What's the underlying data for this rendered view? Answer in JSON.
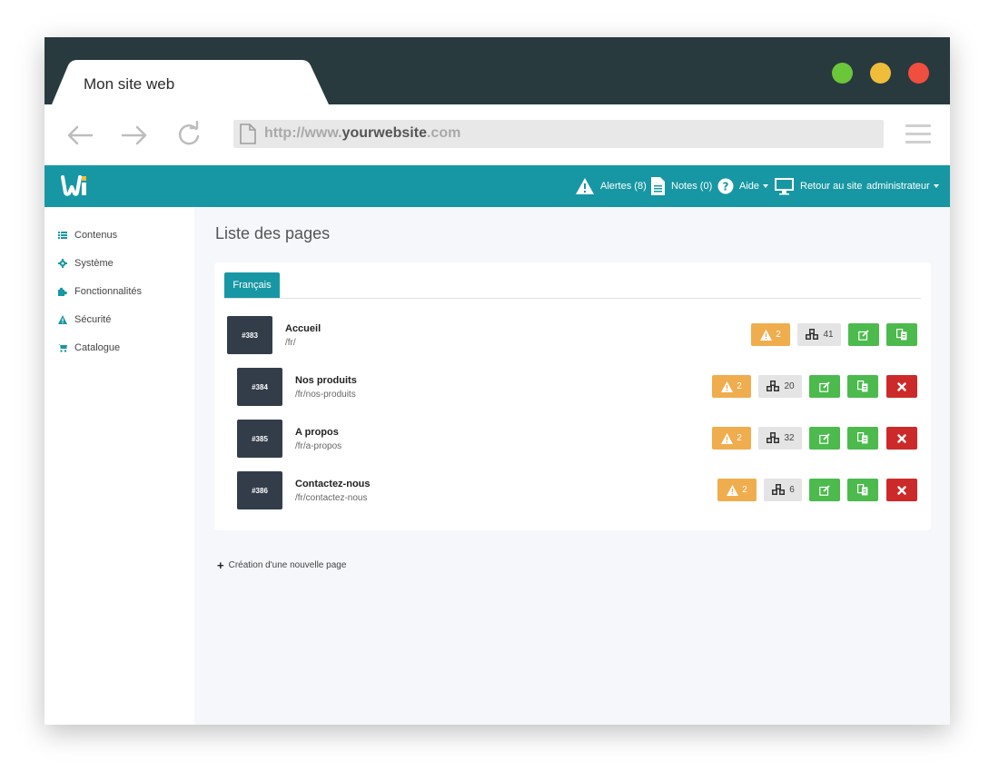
{
  "browser": {
    "tab_title": "Mon site web",
    "url_prefix": "http://www.",
    "url_domain": "yourwebsite",
    "url_suffix": ".com",
    "dots": [
      "#6cc639",
      "#f0bd3a",
      "#f04e3e"
    ]
  },
  "header": {
    "alerts": "Alertes (8)",
    "notes": "Notes (0)",
    "help": "Aide",
    "back_to_site": "Retour au site",
    "user": "administrateur",
    "accent": "#1797a3"
  },
  "sidebar": {
    "items": [
      {
        "label": "Contenus",
        "icon": "list-icon"
      },
      {
        "label": "Système",
        "icon": "gear-icon"
      },
      {
        "label": "Fonctionnalités",
        "icon": "puzzle-icon"
      },
      {
        "label": "Sécurité",
        "icon": "warning-icon"
      },
      {
        "label": "Catalogue",
        "icon": "cart-icon"
      }
    ]
  },
  "main": {
    "title": "Liste des pages",
    "language_tab": "Français",
    "pages": [
      {
        "id": "#383",
        "name": "Accueil",
        "url": "/fr/",
        "alerts": "2",
        "count": "41",
        "deletable": false
      },
      {
        "id": "#384",
        "name": "Nos produits",
        "url": "/fr/nos-produits",
        "alerts": "2",
        "count": "20",
        "deletable": true
      },
      {
        "id": "#385",
        "name": "A propos",
        "url": "/fr/a-propos",
        "alerts": "2",
        "count": "32",
        "deletable": true
      },
      {
        "id": "#386",
        "name": "Contactez-nous",
        "url": "/fr/contactez-nous",
        "alerts": "2",
        "count": "6",
        "deletable": true
      }
    ],
    "new_page": "Création d'une nouvelle page"
  }
}
